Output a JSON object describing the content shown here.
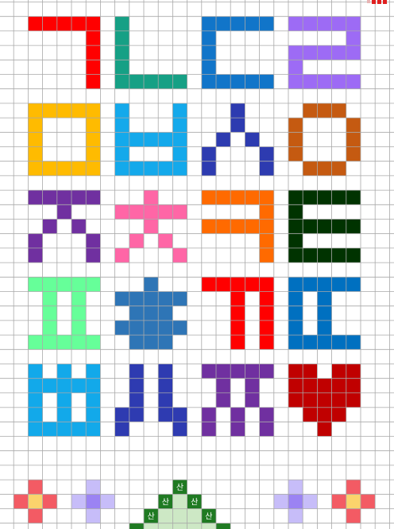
{
  "palette": {
    "grid_line": "#a9a9a9",
    "background": "#ffffff",
    "flower_petal_red": "#f35b64",
    "flower_center_yellow": "#fbd36c",
    "flower_petal_lilac": "#c7bdf9",
    "flower_center_purple": "#9b83f3",
    "mountain_dark": "#1f7a22",
    "mountain_light": "#cde8c5",
    "corner_red": "#e02020"
  },
  "letters": [
    {
      "glyph": "ㄱ",
      "color": "#ff0000"
    },
    {
      "glyph": "ㄴ",
      "color": "#16a085"
    },
    {
      "glyph": "ㄷ",
      "color": "#1175c9"
    },
    {
      "glyph": "ㄹ",
      "color": "#9d6bf5"
    },
    {
      "glyph": "ㅁ",
      "color": "#ffbb00"
    },
    {
      "glyph": "ㅂ",
      "color": "#14a9eb"
    },
    {
      "glyph": "ㅅ",
      "color": "#2d3bb0"
    },
    {
      "glyph": "ㅇ",
      "color": "#c55a11"
    },
    {
      "glyph": "ㅈ",
      "color": "#7030a0"
    },
    {
      "glyph": "ㅊ",
      "color": "#ff66a6"
    },
    {
      "glyph": "ㅋ",
      "color": "#ff6a00"
    },
    {
      "glyph": "ㅌ",
      "color": "#003300"
    },
    {
      "glyph": "ㅍ",
      "color": "#66ff99"
    },
    {
      "glyph": "ㅎ",
      "color": "#2e75b6"
    },
    {
      "glyph": "ㄲ",
      "color": "#ff0000"
    },
    {
      "glyph": "ㄸ",
      "color": "#0070c0"
    },
    {
      "glyph": "ㅃ",
      "color": "#12a9ea"
    },
    {
      "glyph": "ㅆ",
      "color": "#2e3bb1"
    },
    {
      "glyph": "ㅉ",
      "color": "#7030a0"
    },
    {
      "glyph": "heart",
      "color": "#c00000"
    }
  ],
  "border": {
    "mountain_label": "산",
    "items": [
      "red-flower",
      "lilac-flower",
      "mountain",
      "lilac-flower",
      "red-flower"
    ]
  }
}
